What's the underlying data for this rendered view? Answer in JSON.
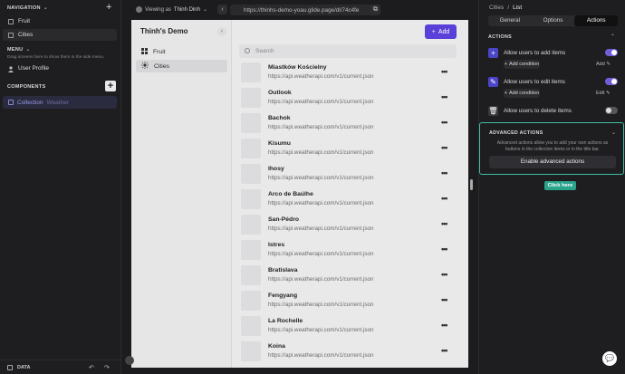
{
  "left": {
    "navigation": {
      "title": "NAVIGATION",
      "items": [
        "Fruit",
        "Cities"
      ]
    },
    "menu": {
      "title": "MENU",
      "hint": "Drag screens here to show them in the side menu.",
      "items": [
        "User Profile"
      ]
    },
    "components": {
      "title": "COMPONENTS",
      "item_label": "Collection",
      "item_sub": "Weather"
    },
    "bottom": {
      "label": "DATA"
    }
  },
  "topbar": {
    "viewing_prefix": "Viewing as",
    "viewing_user": "Thinh Dinh",
    "url": "https://thinhs-demo-yoau.glide.page/dl/74c4fe"
  },
  "app": {
    "title": "Thinh's Demo",
    "nav": [
      "Fruit",
      "Cities"
    ],
    "add_label": "Add",
    "search_placeholder": "Search",
    "rows": [
      {
        "title": "Miastków Kościelny",
        "sub": "https://api.weatherapi.com/v1/current.json"
      },
      {
        "title": "Outlook",
        "sub": "https://api.weatherapi.com/v1/current.json"
      },
      {
        "title": "Bachok",
        "sub": "https://api.weatherapi.com/v1/current.json"
      },
      {
        "title": "Kisumu",
        "sub": "https://api.weatherapi.com/v1/current.json"
      },
      {
        "title": "Ihosy",
        "sub": "https://api.weatherapi.com/v1/current.json"
      },
      {
        "title": "Arco de Baúlhe",
        "sub": "https://api.weatherapi.com/v1/current.json"
      },
      {
        "title": "San-Pédro",
        "sub": "https://api.weatherapi.com/v1/current.json"
      },
      {
        "title": "Istres",
        "sub": "https://api.weatherapi.com/v1/current.json"
      },
      {
        "title": "Bratislava",
        "sub": "https://api.weatherapi.com/v1/current.json"
      },
      {
        "title": "Fengyang",
        "sub": "https://api.weatherapi.com/v1/current.json"
      },
      {
        "title": "La Rochelle",
        "sub": "https://api.weatherapi.com/v1/current.json"
      },
      {
        "title": "Koina",
        "sub": "https://api.weatherapi.com/v1/current.json"
      }
    ]
  },
  "right": {
    "breadcrumb": [
      "Cities",
      "/",
      "List"
    ],
    "tabs": [
      "General",
      "Options",
      "Actions"
    ],
    "actions_title": "ACTIONS",
    "add_items": "Allow users to add items",
    "add_action": "Add condition",
    "add_side": "Add",
    "edit_items": "Allow users to edit items",
    "edit_action": "Add condition",
    "edit_side": "Edit",
    "delete_items": "Allow users to delete items",
    "advanced_title": "ADVANCED ACTIONS",
    "advanced_desc": "Advanced actions allow you to add your own actions as buttons in the collection items or in the title bar.",
    "advanced_button": "Enable advanced actions",
    "click_here": "Click here"
  },
  "colors": {
    "accent": "#5a3fd8",
    "highlight": "#3fbfa8"
  }
}
